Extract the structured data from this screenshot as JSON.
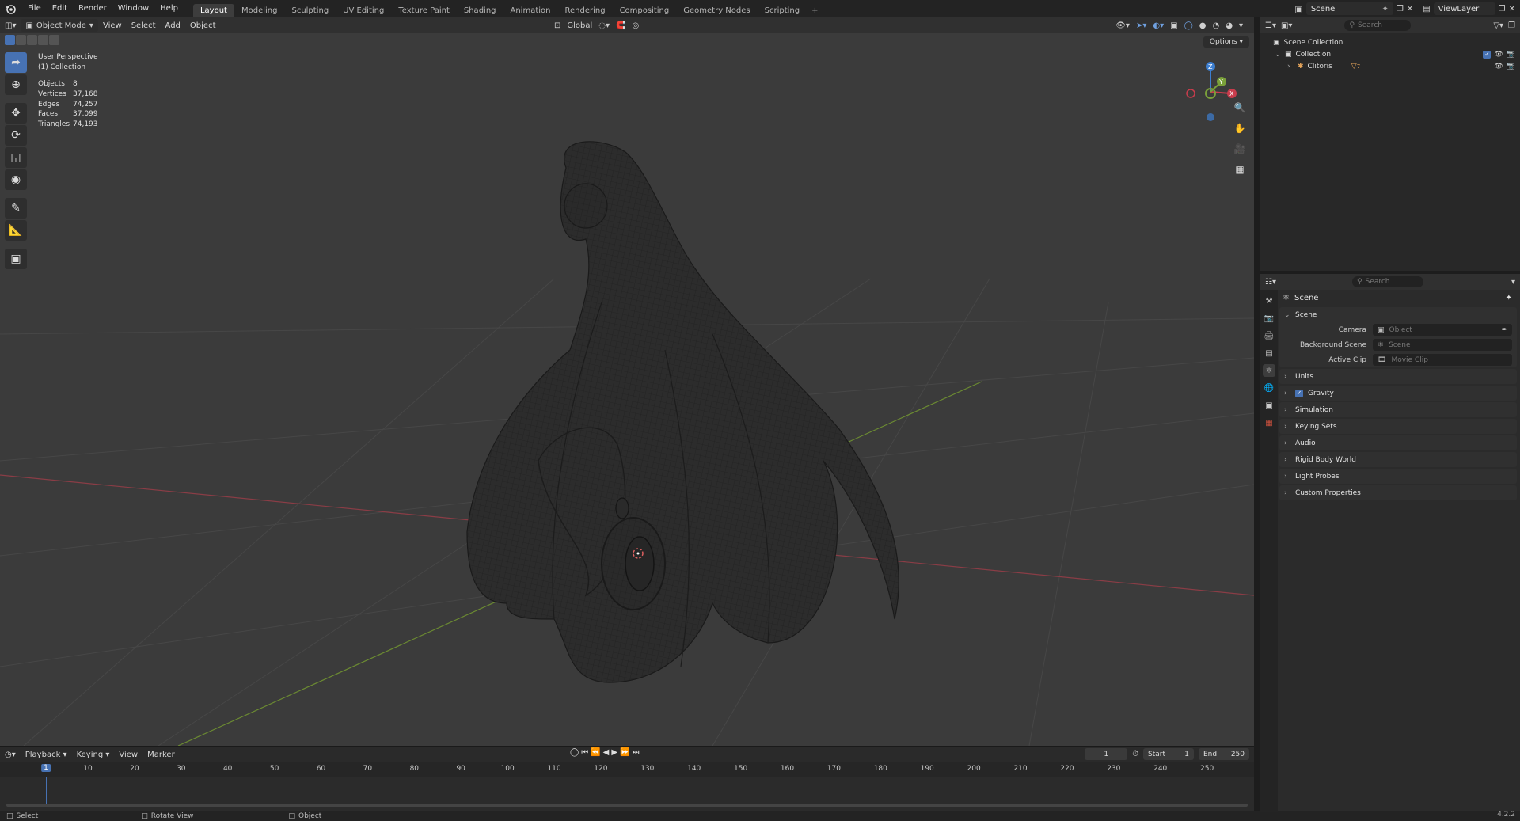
{
  "topbar": {
    "menus": [
      "File",
      "Edit",
      "Render",
      "Window",
      "Help"
    ],
    "workspaces": [
      "Layout",
      "Modeling",
      "Sculpting",
      "UV Editing",
      "Texture Paint",
      "Shading",
      "Animation",
      "Rendering",
      "Compositing",
      "Geometry Nodes",
      "Scripting"
    ],
    "active_workspace": "Layout",
    "add_tab": "+",
    "scene_name": "Scene",
    "view_layer": "ViewLayer"
  },
  "viewport": {
    "mode": "Object Mode",
    "menus": [
      "View",
      "Select",
      "Add",
      "Object"
    ],
    "transform_orientation": "Global",
    "options_label": "Options",
    "info": {
      "perspective": "User Perspective",
      "collection": "(1) Collection"
    },
    "stats": [
      {
        "label": "Objects",
        "value": "8"
      },
      {
        "label": "Vertices",
        "value": "37,168"
      },
      {
        "label": "Edges",
        "value": "74,257"
      },
      {
        "label": "Faces",
        "value": "37,099"
      },
      {
        "label": "Triangles",
        "value": "74,193"
      }
    ],
    "gizmo": {
      "z": "Z",
      "y": "Y",
      "x": "X"
    },
    "axis_colors": {
      "x": "#c83c4c",
      "y": "#7aa03a",
      "z": "#3d7fd1"
    }
  },
  "timeline": {
    "menus": [
      "Playback",
      "Keying",
      "View",
      "Marker"
    ],
    "current_frame": "1",
    "start_label": "Start",
    "start": "1",
    "end_label": "End",
    "end": "250",
    "ruler": [
      "10",
      "20",
      "30",
      "40",
      "50",
      "60",
      "70",
      "80",
      "90",
      "100",
      "110",
      "120",
      "130",
      "140",
      "150",
      "160",
      "170",
      "180",
      "190",
      "200",
      "210",
      "220",
      "230",
      "240",
      "250"
    ],
    "playhead": "1"
  },
  "statusbar": {
    "select": "Select",
    "rotate": "Rotate View",
    "object": "Object",
    "version": "4.2.2"
  },
  "outliner": {
    "search_placeholder": "Search",
    "rows": [
      {
        "label": "Scene Collection"
      },
      {
        "label": "Collection"
      },
      {
        "label": "Clitoris",
        "badge": "7"
      }
    ]
  },
  "properties": {
    "search_placeholder": "Search",
    "context_title": "Scene",
    "scene_panel": {
      "title": "Scene",
      "camera_label": "Camera",
      "camera_placeholder": "Object",
      "background_label": "Background Scene",
      "background_placeholder": "Scene",
      "clip_label": "Active Clip",
      "clip_placeholder": "Movie Clip"
    },
    "panels": [
      "Units",
      "Gravity",
      "Simulation",
      "Keying Sets",
      "Audio",
      "Rigid Body World",
      "Light Probes",
      "Custom Properties"
    ]
  },
  "colors": {
    "accent": "#4772b3",
    "viewport_bg": "#3b3b3b"
  }
}
